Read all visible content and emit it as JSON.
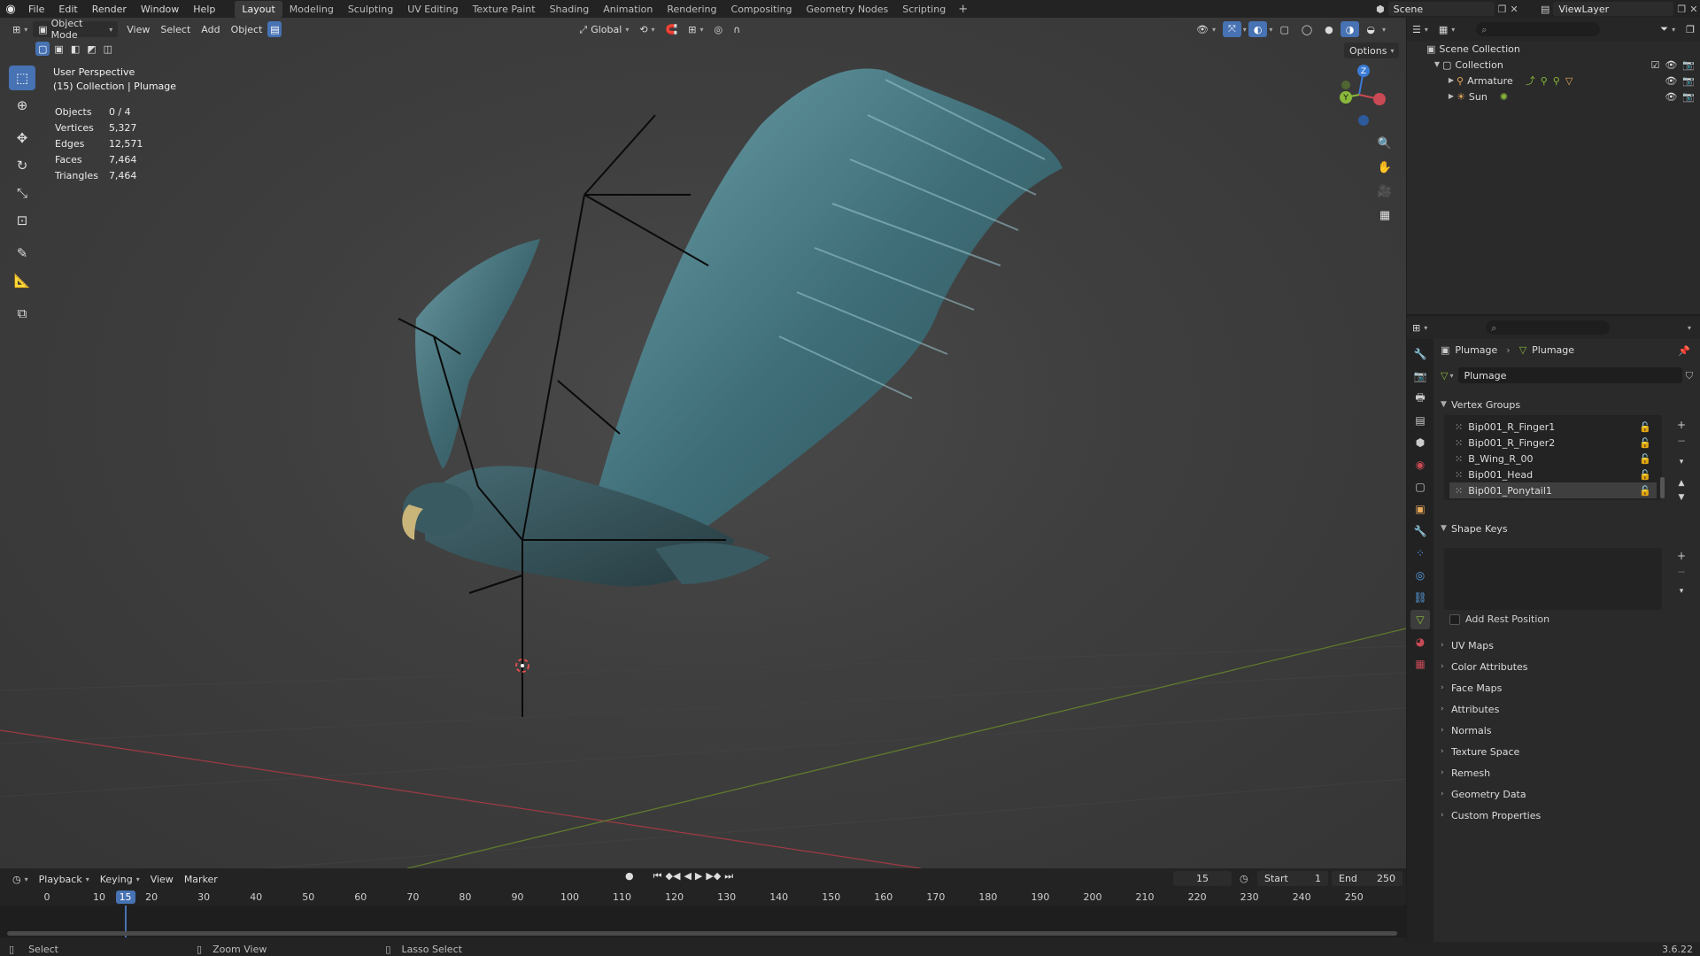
{
  "topbar": {
    "menus": [
      "File",
      "Edit",
      "Render",
      "Window",
      "Help"
    ],
    "workspaces": [
      "Layout",
      "Modeling",
      "Sculpting",
      "UV Editing",
      "Texture Paint",
      "Shading",
      "Animation",
      "Rendering",
      "Compositing",
      "Geometry Nodes",
      "Scripting"
    ],
    "active_workspace": "Layout",
    "scene_name": "Scene",
    "view_layer": "ViewLayer"
  },
  "viewport": {
    "mode": "Object Mode",
    "menus": [
      "View",
      "Select",
      "Add",
      "Object"
    ],
    "transform_orientation": "Global",
    "options_label": "Options",
    "perspective_label": "User Perspective",
    "collection_label": "(15) Collection | Plumage",
    "stats": [
      {
        "label": "Objects",
        "value": "0 / 4"
      },
      {
        "label": "Vertices",
        "value": "5,327"
      },
      {
        "label": "Edges",
        "value": "12,571"
      },
      {
        "label": "Faces",
        "value": "7,464"
      },
      {
        "label": "Triangles",
        "value": "7,464"
      }
    ],
    "gizmo_axes": [
      "Z",
      "Y"
    ]
  },
  "timeline": {
    "menus": [
      "Playback",
      "Keying",
      "View",
      "Marker"
    ],
    "current_frame": "15",
    "start_label": "Start",
    "start": "1",
    "end_label": "End",
    "end": "250",
    "ticks": [
      "0",
      "10",
      "20",
      "30",
      "40",
      "50",
      "60",
      "70",
      "80",
      "90",
      "100",
      "110",
      "120",
      "130",
      "140",
      "150",
      "160",
      "170",
      "180",
      "190",
      "200",
      "210",
      "220",
      "230",
      "240",
      "250"
    ]
  },
  "statusbar": {
    "select": "Select",
    "zoom": "Zoom View",
    "lasso": "Lasso Select",
    "version": "3.6.22"
  },
  "outliner": {
    "rows": [
      "Scene Collection",
      "Collection",
      "Armature",
      "Sun"
    ]
  },
  "properties": {
    "breadcrumb_object": "Plumage",
    "breadcrumb_data": "Plumage",
    "data_name": "Plumage",
    "vertex_groups_title": "Vertex Groups",
    "vertex_groups": [
      "Bip001_R_Finger1",
      "Bip001_R_Finger2",
      "B_Wing_R_00",
      "Bip001_Head",
      "Bip001_Ponytail1"
    ],
    "shape_keys_title": "Shape Keys",
    "add_rest_position": "Add Rest Position",
    "panels": [
      "UV Maps",
      "Color Attributes",
      "Face Maps",
      "Attributes",
      "Normals",
      "Texture Space",
      "Remesh",
      "Geometry Data",
      "Custom Properties"
    ]
  },
  "colors": {
    "accent": "#4772b3",
    "x_axis": "#c94a55",
    "y_axis": "#8ab83a",
    "z_axis": "#3a7bd5",
    "feather": "#4d7f8a"
  }
}
